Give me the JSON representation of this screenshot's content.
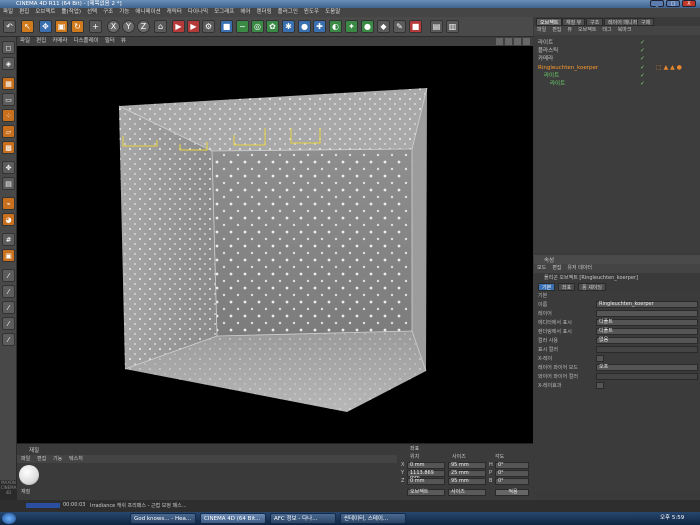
{
  "window": {
    "title": "CINEMA 4D R11 (64 Bit) - [제목없음 2 *]",
    "btn_min": "_",
    "btn_max": "□",
    "btn_close": "X"
  },
  "menu": [
    "파일",
    "편집",
    "오브젝트",
    "툴(작업)",
    "선택",
    "구조",
    "기능",
    "애니메이션",
    "캐릭터",
    "다이나믹",
    "모그래프",
    "헤어",
    "렌더링",
    "플러그인",
    "윈도우",
    "도움말"
  ],
  "viewport": {
    "menu": [
      "파일",
      "편집",
      "카메라",
      "디스플레이",
      "필터",
      "뷰"
    ]
  },
  "object_manager": {
    "tabs": [
      "오브젝트",
      "재질 뷰",
      "구조",
      "레이어 매니저",
      "구매"
    ],
    "menu": [
      "파일",
      "편집",
      "뷰",
      "오브젝트",
      "태그",
      "북마크"
    ],
    "rows": [
      {
        "name": "라이트",
        "indent": 0,
        "tags": "",
        "selected": false
      },
      {
        "name": "플라스틱",
        "indent": 0,
        "tags": "",
        "selected": false
      },
      {
        "name": "카메라",
        "indent": 0,
        "tags": "",
        "selected": false
      },
      {
        "name": "Ringleuchten_koerper",
        "indent": 0,
        "tags": "",
        "selected": true
      },
      {
        "name": "라이트",
        "indent": 1,
        "tags": "",
        "selected": false
      },
      {
        "name": "라이트",
        "indent": 2,
        "tags": "",
        "selected": false
      }
    ]
  },
  "attributes": {
    "header": "속성",
    "menu": [
      "모드",
      "편집",
      "유저 데이터"
    ],
    "title": "폴리곤 오브젝트 [Ringleuchten_koerper]",
    "tabs": [
      "기본",
      "좌표",
      "퐁 셰이딩"
    ],
    "section": "기본",
    "fields": [
      {
        "label": "이름",
        "value": "Ringleuchten_koerper"
      },
      {
        "label": "레이어",
        "value": ""
      },
      {
        "label": "에디터에서 표시",
        "value": "디폴트"
      },
      {
        "label": "렌더링에서 표시",
        "value": "디폴트"
      },
      {
        "label": "컬러 사용",
        "value": "없음"
      },
      {
        "label": "표시 컬러",
        "value": ""
      },
      {
        "label": "X-레이",
        "value": ""
      },
      {
        "label": "레이어 와이어 모드",
        "value": "오프"
      },
      {
        "label": "와이어 와이어 컬러",
        "value": ""
      },
      {
        "label": "X-레이효과",
        "value": ""
      }
    ]
  },
  "material": {
    "header": "재질",
    "menu": [
      "파일",
      "편집",
      "기능",
      "텍스처"
    ],
    "swatch_name": "재질"
  },
  "coordinates": {
    "header": "좌표",
    "col_labels": [
      "위치",
      "사이즈",
      "각도"
    ],
    "rows": [
      {
        "axis": "X",
        "pos": "0 mm",
        "size": "95 mm",
        "rotlabel": "H",
        "rot": "0°"
      },
      {
        "axis": "Y",
        "pos": "1113.869 mm",
        "size": "25 mm",
        "rotlabel": "P",
        "rot": "0°"
      },
      {
        "axis": "Z",
        "pos": "0 mm",
        "size": "95 mm",
        "rotlabel": "B",
        "rot": "0°"
      }
    ],
    "mode1": "오브젝트",
    "mode2": "사이즈",
    "apply": "적용"
  },
  "status": {
    "time": "00:00:03",
    "text": "Irradiance 캐쉬 프리패스 - 근접 보정 패스..."
  },
  "taskbar": {
    "tasks": [
      "God knows... - Hea...",
      "CINEMA 4D (64 Bit...",
      "AFC 정보 - 다나...",
      "씬데이터, 스테이..."
    ],
    "clock": "오후 5:59"
  },
  "side_logo": "MAXON CINEMA 4D"
}
